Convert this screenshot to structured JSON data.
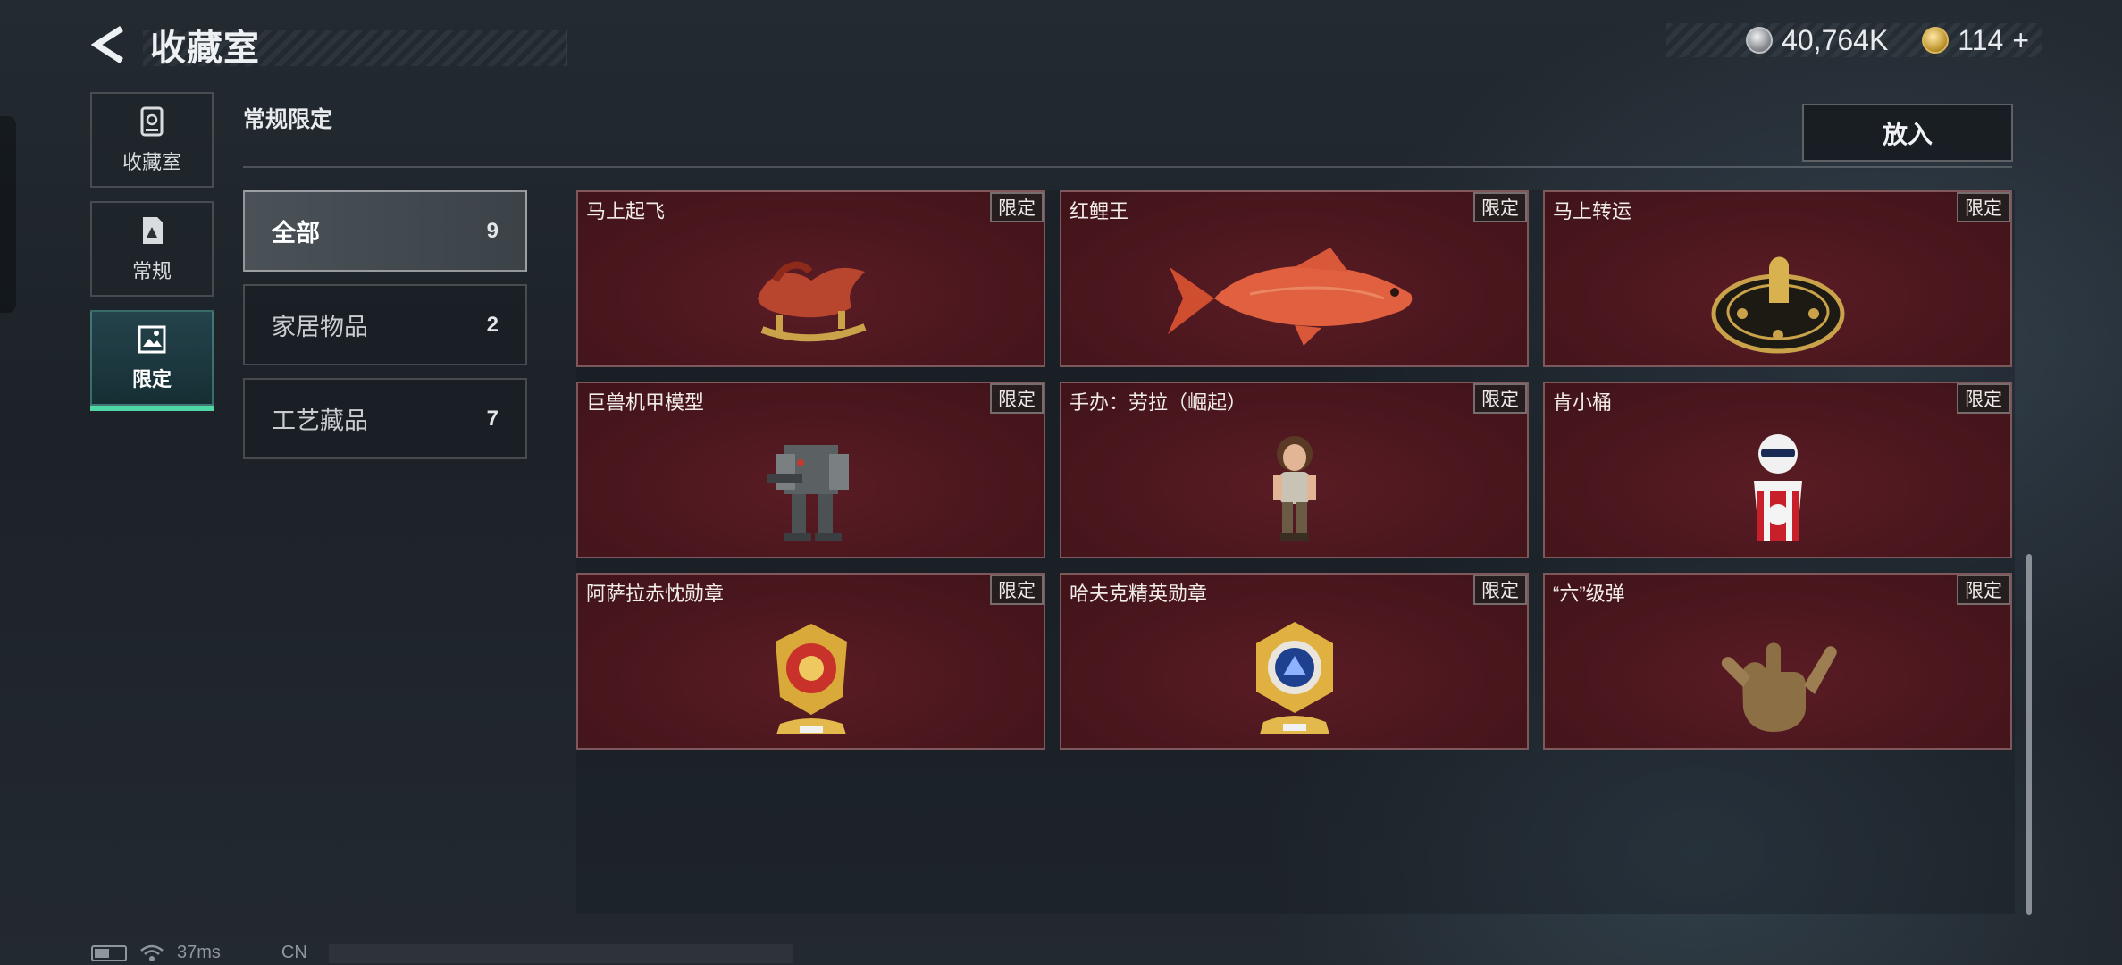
{
  "header": {
    "title": "收藏室"
  },
  "currency": {
    "silver": "40,764K",
    "gold": "114",
    "gold_add": "+"
  },
  "sidenav": [
    {
      "label": "收藏室",
      "icon": "vault-icon",
      "active": false
    },
    {
      "label": "常规",
      "icon": "document-icon",
      "active": false
    },
    {
      "label": "限定",
      "icon": "image-frame-icon",
      "active": true
    }
  ],
  "section": {
    "title": "常规限定",
    "put_label": "放入"
  },
  "categories": [
    {
      "name": "全部",
      "count": "9"
    },
    {
      "name": "家居物品",
      "count": "2"
    },
    {
      "name": "工艺藏品",
      "count": "7"
    }
  ],
  "items": [
    {
      "name": "马上起飞",
      "tag": "限定",
      "icon": "horse-figurine-icon"
    },
    {
      "name": "红鲤王",
      "tag": "限定",
      "icon": "red-carp-icon"
    },
    {
      "name": "马上转运",
      "tag": "限定",
      "icon": "fortune-wheel-icon"
    },
    {
      "name": "巨兽机甲模型",
      "tag": "限定",
      "icon": "mech-model-icon"
    },
    {
      "name": "手办：劳拉（崛起）",
      "tag": "限定",
      "icon": "lara-figure-icon"
    },
    {
      "name": "肯小桶",
      "tag": "限定",
      "icon": "bucket-figure-icon"
    },
    {
      "name": "阿萨拉赤忱勋章",
      "tag": "限定",
      "icon": "red-medal-icon"
    },
    {
      "name": "哈夫克精英勋章",
      "tag": "限定",
      "icon": "blue-medal-icon"
    },
    {
      "name": "“六”级弹",
      "tag": "限定",
      "icon": "hand-gesture-icon"
    }
  ],
  "status": {
    "ping": "37ms",
    "region": "CN"
  },
  "colors": {
    "accent": "#4fd7a6",
    "card_bg": "#4a161d"
  }
}
